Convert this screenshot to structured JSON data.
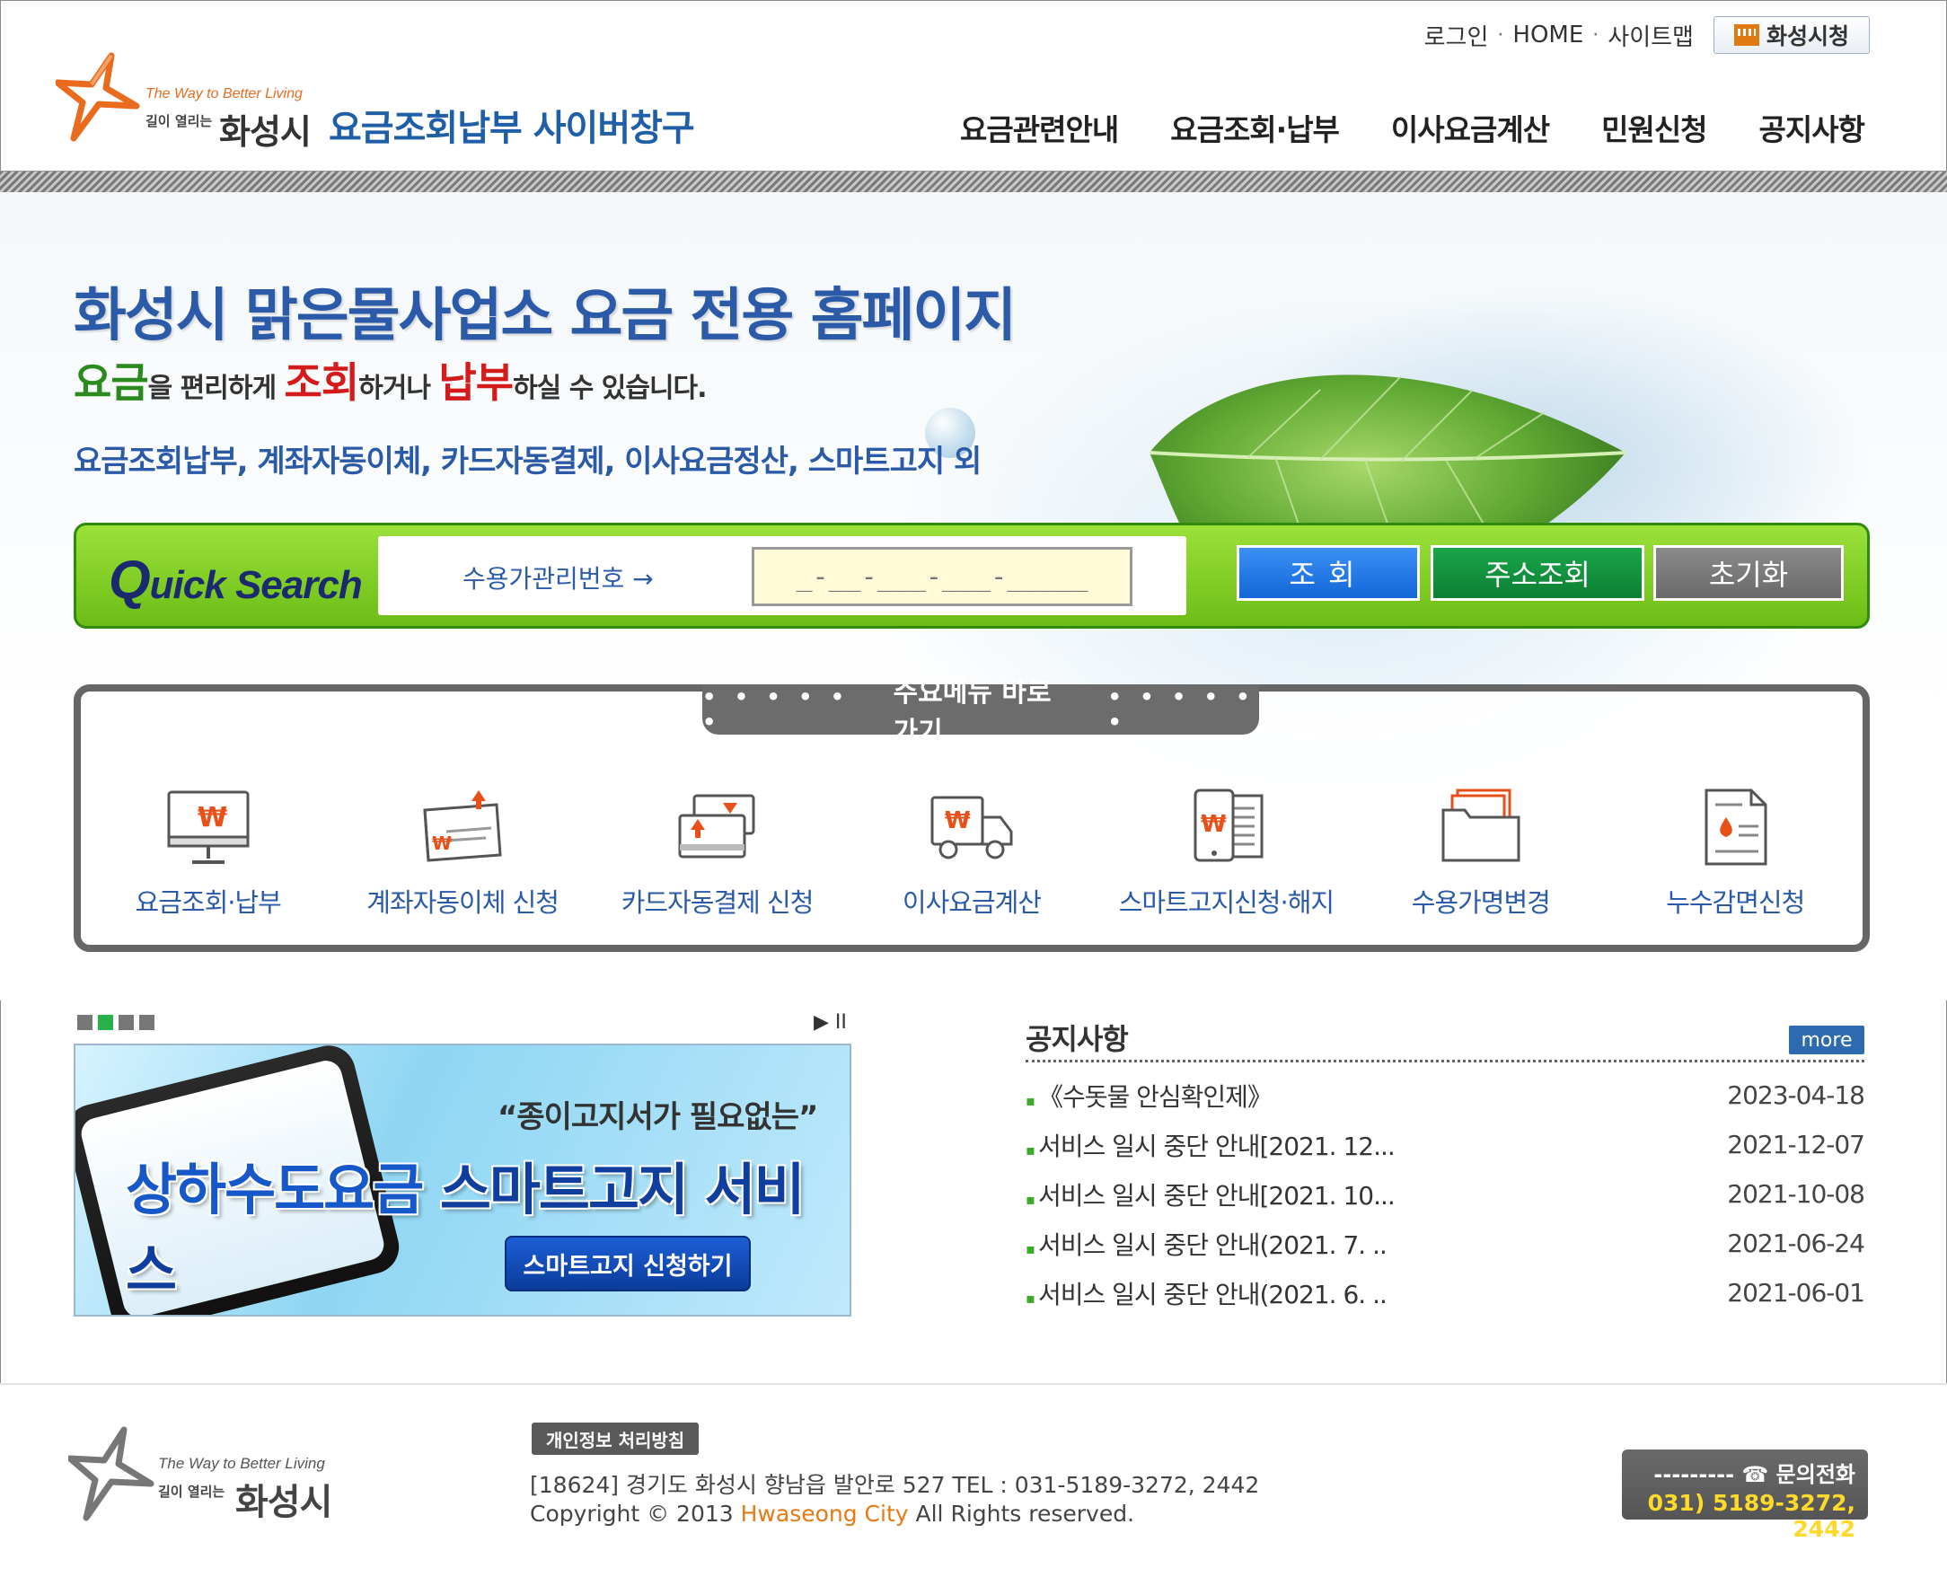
{
  "topbar": {
    "login": "로그인",
    "home": "HOME",
    "sitemap": "사이트맵",
    "city_hall": "화성시청"
  },
  "logo": {
    "tagline": "The Way to Better Living",
    "subline": "길이 열리는",
    "city": "화성시"
  },
  "site_title": "요금조회납부 사이버창구",
  "gnb": [
    "요금관련안내",
    "요금조회·납부",
    "이사요금계산",
    "민원신청",
    "공지사항"
  ],
  "hero": {
    "title": "화성시 맑은물사업소 요금 전용 홈페이지",
    "sub_w1": "요금",
    "sub_t1": "을 편리하게 ",
    "sub_w2": "조회",
    "sub_t2": "하거나 ",
    "sub_w3": "납부",
    "sub_t3": "하실 수 있습니다.",
    "services": "요금조회납부, 계좌자동이체, 카드자동결제, 이사요금정산, 스마트고지 외"
  },
  "quick_search": {
    "logo_q": "Q",
    "logo_rest": "uick Search",
    "label": "수용가관리번호 →",
    "input_value": "_-__-___-___-_____",
    "search_btn": "조회",
    "address_btn": "주소조회",
    "reset_btn": "초기화"
  },
  "shortcut": {
    "title": "주요메뉴 바로가기",
    "dots": "• • • • • •",
    "items": [
      {
        "label": "요금조회·납부",
        "icon": "monitor-won-icon"
      },
      {
        "label": "계좌자동이체 신청",
        "icon": "bankbook-icon"
      },
      {
        "label": "카드자동결제 신청",
        "icon": "card-icon"
      },
      {
        "label": "이사요금계산",
        "icon": "truck-icon"
      },
      {
        "label": "스마트고지신청·해지",
        "icon": "smartphone-icon"
      },
      {
        "label": "수용가명변경",
        "icon": "folder-icon"
      },
      {
        "label": "누수감면신청",
        "icon": "document-drop-icon"
      }
    ]
  },
  "banner": {
    "quote": "“종이고지서가 필요없는”",
    "big_a": "상하수도요금 ",
    "big_b": "스마트고지 서비스",
    "cta": "스마트고지 신청하기",
    "pager_count": 4,
    "pager_active": 2,
    "controls": "▶ II"
  },
  "notices": {
    "title": "공지사항",
    "more": "more",
    "items": [
      {
        "title": "《수돗물 안심확인제》",
        "date": "2023-04-18"
      },
      {
        "title": "서비스 일시 중단 안내[2021. 12...",
        "date": "2021-12-07"
      },
      {
        "title": "서비스 일시 중단 안내[2021. 10...",
        "date": "2021-10-08"
      },
      {
        "title": "서비스 일시 중단 안내(2021. 7. ..",
        "date": "2021-06-24"
      },
      {
        "title": "서비스 일시 중단 안내(2021. 6. ..",
        "date": "2021-06-01"
      }
    ]
  },
  "footer": {
    "privacy": "개인정보 처리방침",
    "address": "[18624] 경기도 화성시 향남읍 발안로 527   TEL : 031-5189-3272, 2442",
    "copy_a": "Copyright © 2013 ",
    "copy_city": "Hwaseong City",
    "copy_b": " All Rights reserved.",
    "tel_label": "--------- ☎ 문의전화",
    "tel_number": "031) 5189-3272, 2442"
  },
  "colors": {
    "brand_blue": "#2a5aa8",
    "quick_green": "#7ccd1f",
    "search_blue": "#1467d8",
    "address_green": "#0d7f34",
    "reset_gray": "#6a6a6a",
    "accent_orange": "#e87a14"
  }
}
